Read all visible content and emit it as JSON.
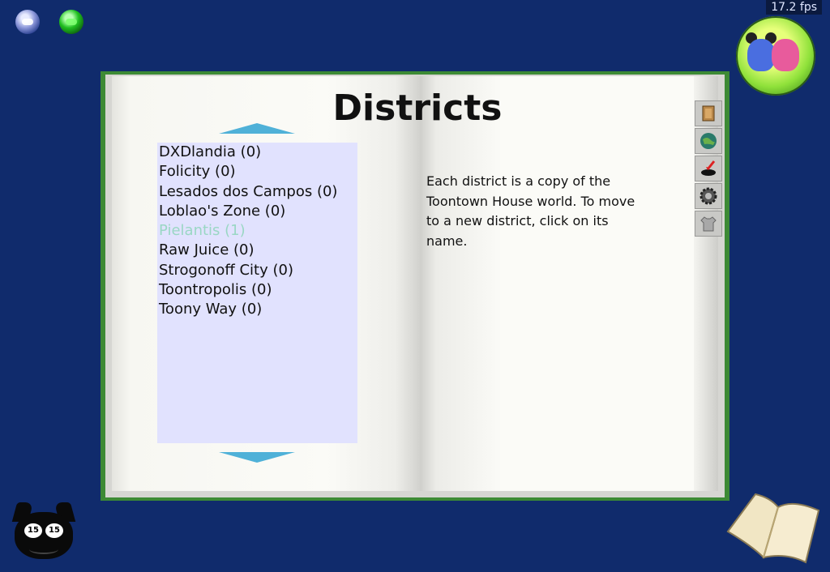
{
  "hud": {
    "fps": "17.2 fps",
    "laff_left_eye": "15",
    "laff_right_eye": "15"
  },
  "book": {
    "title": "Districts",
    "districts": [
      {
        "label": "DXDlandia (0)"
      },
      {
        "label": "Folicity (0)"
      },
      {
        "label": "Lesados dos Campos (0)"
      },
      {
        "label": "Loblao's Zone (0)"
      },
      {
        "label": "Pielantis (1)"
      },
      {
        "label": "Raw Juice (0)"
      },
      {
        "label": "Strogonoff City (0)"
      },
      {
        "label": "Toontropolis (0)"
      },
      {
        "label": "Toony Way (0)"
      }
    ],
    "info_text": "Each district is a copy of the Toontown House world. To move to a new district, click on its name.",
    "tabs": [
      "map-tab-icon",
      "world-tab-icon",
      "portal-tab-icon",
      "options-tab-icon",
      "clothing-tab-icon"
    ]
  },
  "colors": {
    "background": "#102b6c",
    "book_border": "#3d8a35",
    "list_background": "#e1e2fe",
    "current_district": "#9ad7c4",
    "scroll_arrow": "#4fb1d8"
  }
}
